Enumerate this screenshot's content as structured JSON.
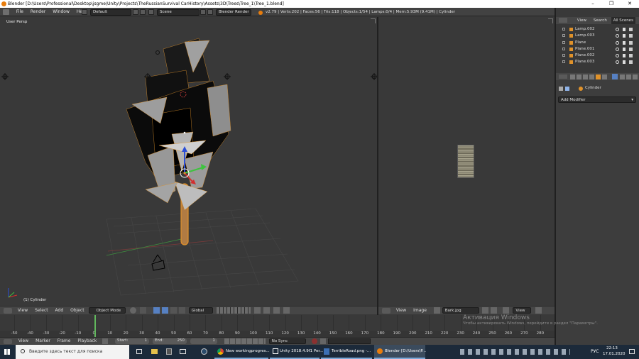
{
  "window": {
    "title": "Blender [D:\\Users\\Professional\\Desktop\\jsgme\\Unity\\Projects\\TheRussianSurvival CarHistory\\Assets\\3D\\Trees\\Tree_1\\Tree_1.blend]",
    "controls": [
      "–",
      "❐",
      "✕"
    ]
  },
  "menubar": {
    "items": [
      "File",
      "Render",
      "Window",
      "Help"
    ],
    "layout": "Default",
    "scene": "Scene",
    "engine": "Blender Render",
    "stats": "v2.79 | Verts:202 | Faces:56 | Tris:118 | Objects:1/54 | Lamps:0/4 | Mem:5.93M (9.41M) | Cylinder"
  },
  "viewport3d": {
    "label": "User Persp",
    "object_label": "(1) Cylinder"
  },
  "header3d": {
    "items": [
      "View",
      "Select",
      "Add",
      "Object"
    ],
    "mode": "Object Mode",
    "orientation": "Global"
  },
  "image_editor": {
    "items": [
      "View",
      "Image"
    ],
    "image_name": "Bark.jpg",
    "view_menu": "View"
  },
  "outliner": {
    "tabs": [
      "View",
      "Search",
      "All Scenes"
    ],
    "rows": [
      "Lamp.002",
      "Lamp.003",
      "Plane",
      "Plane.001",
      "Plane.002",
      "Plane.003"
    ]
  },
  "properties": {
    "object_name": "Cylinder",
    "add_modifier": "Add Modifier"
  },
  "timeline": {
    "ticks": [
      "-50",
      "-40",
      "-30",
      "-20",
      "-10",
      "0",
      "10",
      "20",
      "30",
      "40",
      "50",
      "60",
      "70",
      "80",
      "90",
      "100",
      "110",
      "120",
      "130",
      "140",
      "150",
      "160",
      "170",
      "180",
      "190",
      "200",
      "210",
      "220",
      "230",
      "240",
      "250",
      "260",
      "270",
      "280"
    ],
    "current_frame": "0",
    "menu": [
      "View",
      "Marker",
      "Frame",
      "Playback"
    ],
    "start_label": "Start:",
    "start": "1",
    "end_label": "End:",
    "end": "250",
    "frame": "1",
    "sync": "No Sync"
  },
  "watermark": {
    "line1": "Активация Windows",
    "line2": "Чтобы активировать Windows, перейдите в раздел \"Параметры\"."
  },
  "taskbar": {
    "search_placeholder": "Введите здесь текст для поиска",
    "apps": [
      "New workingprogres...",
      "Unity 2018.4.9f1 Per...",
      "TerribleRoad.png -...",
      "Blender [D:\\Users\\P..."
    ],
    "lang": "РУС",
    "time": "22:13",
    "date": "17.01.2020"
  },
  "colors": {
    "accent": "#5680c2",
    "frame_line": "#62b85e",
    "object_highlight": "#e0922a"
  }
}
